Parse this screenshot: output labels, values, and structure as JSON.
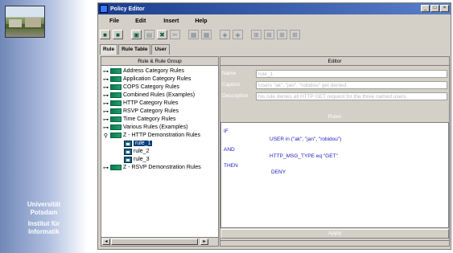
{
  "branding": {
    "line1": "Universität",
    "line2": "Potsdam",
    "line3": "Institut für",
    "line4": "Informatik"
  },
  "window": {
    "title": "Policy Editor",
    "min_label": "_",
    "max_label": "□",
    "close_label": "×"
  },
  "menu": [
    "File",
    "Edit",
    "Insert",
    "Help"
  ],
  "tabs": [
    "Rule",
    "Rule Table",
    "User"
  ],
  "tree": {
    "header": "Rule & Rule Group",
    "items": [
      "Address Category Rules",
      "Application Category Rules",
      "COPS Category Rules",
      "Combined Rules (Examples)",
      "HTTP Category Rules",
      "RSVP Category Rules",
      "Time Category Rules",
      "Various Rules (Examples)",
      "Z - HTTP Demonstration Rules",
      "rule_1",
      "rule_2",
      "rule_3",
      "Z - RSVP Demonstration Rules"
    ]
  },
  "editor": {
    "header": "Editor",
    "name_label": "Name",
    "name_value": "rule_1",
    "caption_label": "Caption",
    "caption_value": "Users \"ak\", \"jan\", \"robidou\" get denied.",
    "description_label": "Description",
    "description_value": "his rule denies all HTTP GET request for the three named users",
    "rules_header": "Rules",
    "rules": {
      "if_kw": "IF",
      "if_expr": "USER in (\"ak\", \"jan\", \"robidou\")",
      "and_kw": "AND",
      "and_expr": "HTTP_MSG_TYPE eq \"GET\"",
      "then_kw": "THEN",
      "then_expr": "DENY"
    },
    "apply_label": "Apply"
  }
}
